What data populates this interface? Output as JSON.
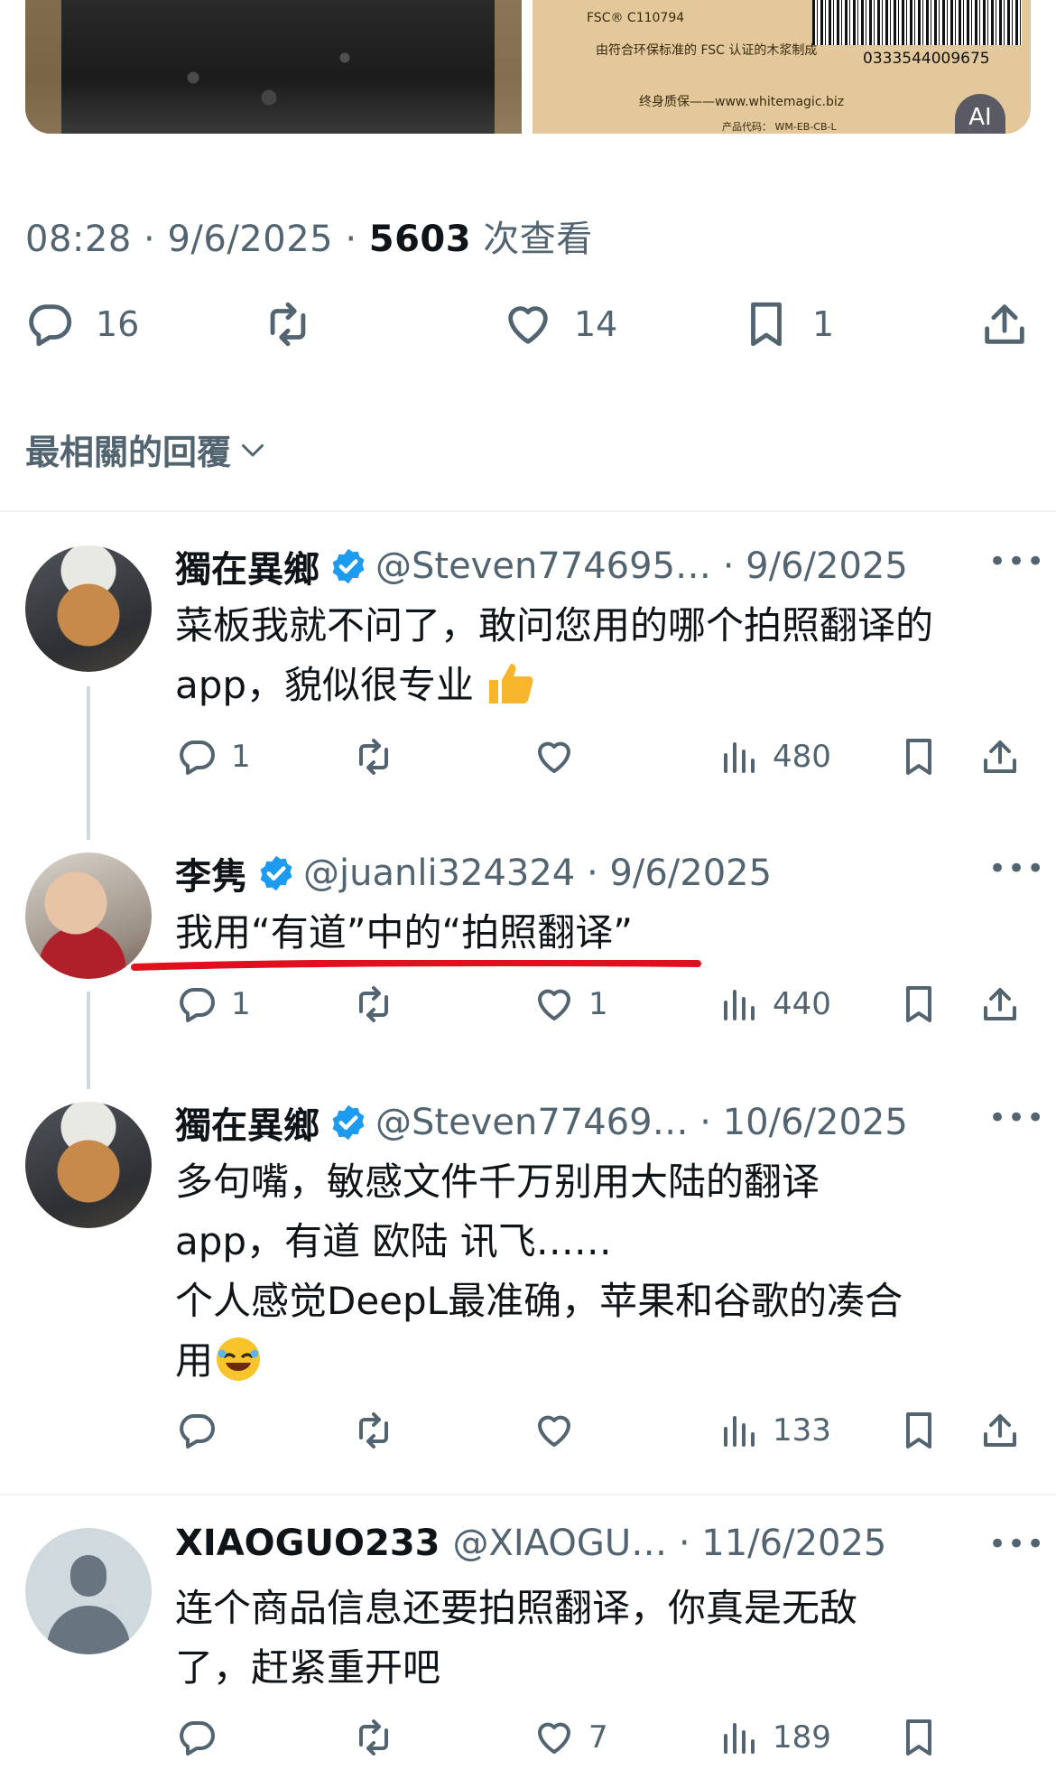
{
  "post": {
    "image_right_text": {
      "fsc": "FSC® C110794",
      "line1": "由符合环保标准的 FSC 认证的木浆制成",
      "barcode_number": "0333544009675",
      "warranty": "终身质保——www.whitemagic.biz",
      "product_code": "产品代码：  WM-EB-CB-L"
    },
    "time": "08:28",
    "date": "9/6/2025",
    "views_count": "5603",
    "views_label": "次查看",
    "replies": "16",
    "likes": "14",
    "bookmarks": "1",
    "ai_badge": "AI"
  },
  "sort_label": "最相關的回覆",
  "replies": [
    {
      "name": "獨在異鄉",
      "handle": "@Steven774695…",
      "date": "9/6/2025",
      "text": "菜板我就不问了，敢问您用的哪个拍照翻译的app，貌似很专业",
      "reply_count": "1",
      "like_count": "",
      "views": "480"
    },
    {
      "name": "李隽",
      "handle": "@juanli324324",
      "date": "9/6/2025",
      "text": "我用“有道”中的“拍照翻译”",
      "reply_count": "1",
      "like_count": "1",
      "views": "440"
    },
    {
      "name": "獨在異鄉",
      "handle": "@Steven77469…",
      "date": "10/6/2025",
      "text_l1": "多句嘴，敏感文件千万别用大陆的翻译",
      "text_l2": "app，有道 欧陆 讯飞……",
      "text_l3": "个人感觉DeepL最准确，苹果和谷歌的凑合",
      "text_l4": "用",
      "reply_count": "",
      "like_count": "",
      "views": "133"
    },
    {
      "name": "XIAOGUO233",
      "handle": "@XIAOGU…",
      "date": "11/6/2025",
      "text_l1": "连个商品信息还要拍照翻译，你真是无敌",
      "text_l2": "了，赶紧重开吧",
      "reply_count": "",
      "like_count": "7",
      "views": "189"
    }
  ],
  "colors": {
    "text": "#0f1419",
    "secondary": "#536471",
    "verified": "#1d9bf0",
    "annotation": "#e0101e"
  },
  "icons": [
    "reply-icon",
    "retweet-icon",
    "like-icon",
    "bookmark-icon",
    "share-icon",
    "views-icon",
    "verified-icon",
    "more-icon",
    "chevron-down-icon"
  ]
}
